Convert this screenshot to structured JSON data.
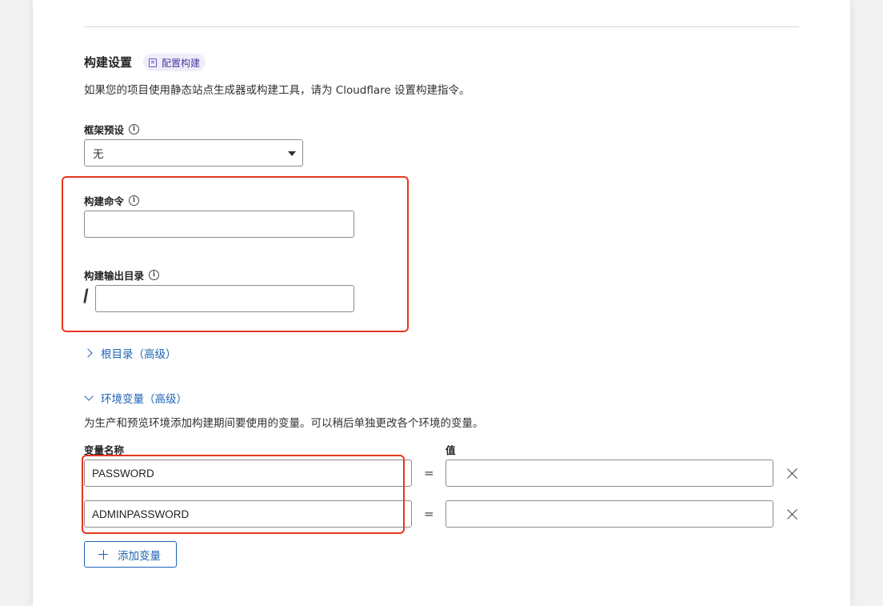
{
  "build_settings": {
    "title": "构建设置",
    "config_badge": "配置构建",
    "description": "如果您的项目使用静态站点生成器或构建工具，请为 Cloudflare 设置构建指令。",
    "framework_preset": {
      "label": "框架预设",
      "value": "无"
    },
    "build_command": {
      "label": "构建命令",
      "value": ""
    },
    "output_dir": {
      "label": "构建输出目录",
      "prefix": "/",
      "value": ""
    },
    "root_dir_expander": "根目录（高级）"
  },
  "env_vars": {
    "expander": "环境变量（高级）",
    "description": "为生产和预览环境添加构建期间要使用的变量。可以稍后单独更改各个环境的变量。",
    "name_header": "变量名称",
    "value_header": "值",
    "equals": "=",
    "rows": [
      {
        "name": "PASSWORD",
        "value": ""
      },
      {
        "name": "ADMINPASSWORD",
        "value": ""
      }
    ],
    "add_button": "添加变量"
  },
  "colors": {
    "accent": "#1e63b4",
    "highlight": "#e6361f",
    "badge_bg": "#efedfa"
  }
}
